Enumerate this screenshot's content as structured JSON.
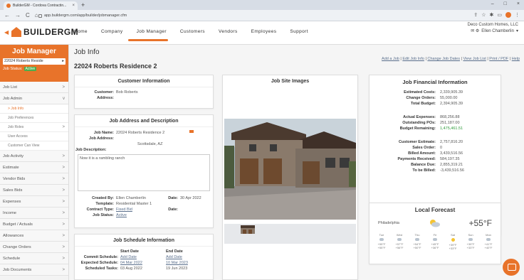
{
  "browser": {
    "tab_title": "BuilderGM - Cordova Contractin...",
    "tab_close": "×",
    "new_tab": "+",
    "window_controls": [
      "–",
      "□",
      "×"
    ],
    "nav_glyphs": [
      "←",
      "→",
      "C",
      "⌂"
    ],
    "url": "app.buildergm.com/app/builder/jobmanager.cfm",
    "icons": [
      "share-icon",
      "star-icon",
      "puzzle-icon",
      "tablet-icon",
      "profile-icon",
      "menu-icon"
    ]
  },
  "header": {
    "logo_text": "BUILDERGM",
    "nav": [
      "Home",
      "Company",
      "Job Manager",
      "Customers",
      "Vendors",
      "Employees",
      "Support"
    ],
    "active_nav": "Job Manager",
    "company": "Deco Custom Homes, LLC",
    "user": "Ellen Chamberlin",
    "user_chevron": "▾",
    "user_icons": "✉ ⚙"
  },
  "sidebar": {
    "title": "Job Manager",
    "selected_job": "22024 Roberts Reside",
    "select_chevron": "▸",
    "status_label": "Job Status:",
    "status_value": "Active",
    "items": [
      {
        "label": "Job List",
        "chev": ">"
      },
      {
        "label": "Job Admin",
        "chev": "v"
      },
      {
        "label": "> Job Info",
        "sub": true,
        "current": true
      },
      {
        "label": "Job Preferences",
        "sub": true
      },
      {
        "label": "Job Roles",
        "sub": true,
        "chev": ">"
      },
      {
        "label": "User Access",
        "sub": true
      },
      {
        "label": "Customer Can View",
        "sub": true
      },
      {
        "label": "Job Activity",
        "chev": ">"
      },
      {
        "label": "Estimate",
        "chev": ">"
      },
      {
        "label": "Vendor Bids",
        "chev": ">"
      },
      {
        "label": "Sales Bids",
        "chev": ">"
      },
      {
        "label": "Expenses",
        "chev": ">"
      },
      {
        "label": "Income",
        "chev": ">"
      },
      {
        "label": "Budget / Actuals",
        "chev": ">"
      },
      {
        "label": "Allowances",
        "chev": ">"
      },
      {
        "label": "Change Orders",
        "chev": ">"
      },
      {
        "label": "Schedule",
        "chev": ">"
      },
      {
        "label": "Job Documents",
        "chev": ">"
      }
    ]
  },
  "main": {
    "page_title": "Job Info",
    "job_title": "22024 Roberts Residence 2",
    "quick_links": [
      "Add a Job",
      "Edit Job Info",
      "Change Job Dates",
      "View Job List",
      "Print / PDF",
      "Help"
    ],
    "quick_sep": "|"
  },
  "customer_info": {
    "title": "Customer Information",
    "customer_label": "Customer:",
    "customer": "Bob Roberts",
    "address_label": "Address:"
  },
  "job_address": {
    "title": "Job Address and Description",
    "job_name_label": "Job Name:",
    "job_name": "22024 Roberts Residence 2",
    "job_address_label": "Job Address:",
    "city": "Scottsdale, AZ",
    "desc_label": "Job Description:",
    "description": "Now it is a rambling ranch",
    "created_by_label": "Created By:",
    "created_by": "Ellen Chamberlin",
    "date_label": "Date:",
    "created_date": "30 Apr 2022",
    "template_label": "Template:",
    "template": "Residential Master 1",
    "contract_label": "Contract Type:",
    "contract": "Fixed Bid",
    "date2_label": "Date:",
    "job_status_label": "Job Status:",
    "job_status": "Active"
  },
  "schedule": {
    "title": "Job Schedule Information",
    "start_header": "Start Date",
    "end_header": "End Date",
    "rows": [
      {
        "label": "Commit Schedule:",
        "start": "Add Date",
        "end": "Add Date",
        "start_link": true,
        "end_link": true
      },
      {
        "label": "Expected Schedule:",
        "start": "04 Mar 2022",
        "end": "10 Mar 2023",
        "start_link": true,
        "end_link": true
      },
      {
        "label": "Scheduled Tasks:",
        "start": "03 Aug 2022",
        "end": "19 Jun 2023",
        "start_link": false,
        "end_link": false
      }
    ]
  },
  "site_images": {
    "title": "Job Site Images"
  },
  "financial": {
    "title": "Job Financial Information",
    "group1": [
      {
        "label": "Estimated Costs:",
        "value": "2,339,905.39"
      },
      {
        "label": "Change Orders:",
        "value": "55,000.00"
      },
      {
        "label": "Total Budget:",
        "value": "2,394,905.39"
      }
    ],
    "group2": [
      {
        "label": "Actual Expenses:",
        "value": "868,256.88"
      },
      {
        "label": "Outstanding POs:",
        "value": "251,187.00"
      },
      {
        "label": "Budget Remaining:",
        "value": "1,475,461.51",
        "green": true
      }
    ],
    "group3": [
      {
        "label": "Customer Estimate:",
        "value": "2,757,816.20"
      },
      {
        "label": "Sales Order:",
        "value": "0"
      },
      {
        "label": "Billed Amount:",
        "value": "3,439,516.56"
      },
      {
        "label": "Payments Received:",
        "value": "584,197.35"
      },
      {
        "label": "Balance Due:",
        "value": "2,855,319.21"
      },
      {
        "label": "To be Billed:",
        "value": "-3,439,516.56"
      }
    ]
  },
  "forecast": {
    "title": "Local Forecast",
    "city": "Philadelphia",
    "temp": "+55°F",
    "days": [
      {
        "d": "Tue",
        "hi": "+55°F",
        "lo": "+55°F",
        "icon": "cloud"
      },
      {
        "d": "Wed",
        "hi": "+57°F",
        "lo": "+56°F",
        "icon": "cloud"
      },
      {
        "d": "Thu",
        "hi": "+54°F",
        "lo": "+50°F",
        "icon": "cloud"
      },
      {
        "d": "Fri",
        "hi": "+45°F",
        "lo": "+36°F",
        "icon": "cloud"
      },
      {
        "d": "Sat",
        "hi": "+39°F",
        "lo": "+33°F",
        "icon": "sun"
      },
      {
        "d": "Sun",
        "hi": "+39°F",
        "lo": "+33°F",
        "icon": "cloud"
      },
      {
        "d": "Mon",
        "hi": "+41°F",
        "lo": "+40°F",
        "icon": "cloud"
      }
    ]
  },
  "colors": {
    "accent": "#e8732a",
    "active": "#4cae4c",
    "link": "#5a6f8c"
  }
}
